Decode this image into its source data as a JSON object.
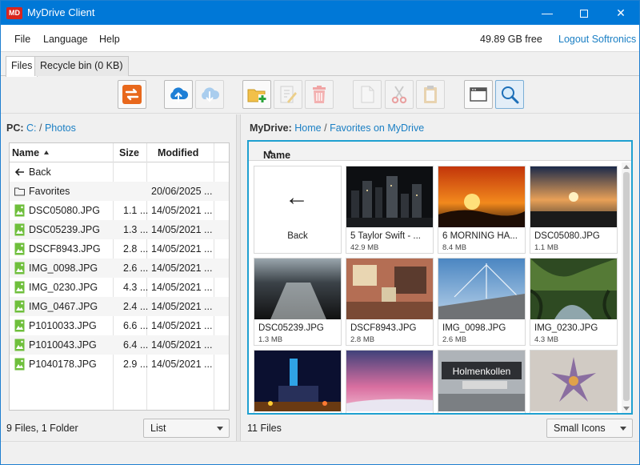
{
  "window": {
    "title": "MyDrive Client",
    "logo_text": "MD"
  },
  "menu": {
    "items": [
      "File",
      "Language",
      "Help"
    ],
    "free_space": "49.89 GB free",
    "logout": "Logout Softronics"
  },
  "tabs": [
    {
      "label": "Files",
      "active": true
    },
    {
      "label": "Recycle bin (0 KB)",
      "active": false
    }
  ],
  "toolbar": {
    "buttons": [
      "sync-icon",
      "upload-icon",
      "download-icon",
      "new-folder-icon",
      "rename-icon",
      "delete-icon",
      "copy-icon",
      "cut-icon",
      "paste-icon",
      "window-icon",
      "search-icon"
    ]
  },
  "left": {
    "path_label": "PC:",
    "path": [
      "C:",
      "Photos"
    ],
    "columns": [
      "Name",
      "Size",
      "Modified"
    ],
    "rows": [
      {
        "name": "Back",
        "size": "",
        "modified": "",
        "icon": "back-arrow-icon"
      },
      {
        "name": "Favorites",
        "size": "",
        "modified": "20/06/2025 ...",
        "icon": "folder-icon"
      },
      {
        "name": "DSC05080.JPG",
        "size": "1.1 ...",
        "modified": "14/05/2021 ...",
        "icon": "image-file-icon"
      },
      {
        "name": "DSC05239.JPG",
        "size": "1.3 ...",
        "modified": "14/05/2021 ...",
        "icon": "image-file-icon"
      },
      {
        "name": "DSCF8943.JPG",
        "size": "2.8 ...",
        "modified": "14/05/2021 ...",
        "icon": "image-file-icon"
      },
      {
        "name": "IMG_0098.JPG",
        "size": "2.6 ...",
        "modified": "14/05/2021 ...",
        "icon": "image-file-icon"
      },
      {
        "name": "IMG_0230.JPG",
        "size": "4.3 ...",
        "modified": "14/05/2021 ...",
        "icon": "image-file-icon"
      },
      {
        "name": "IMG_0467.JPG",
        "size": "2.4 ...",
        "modified": "14/05/2021 ...",
        "icon": "image-file-icon"
      },
      {
        "name": "P1010033.JPG",
        "size": "6.6 ...",
        "modified": "14/05/2021 ...",
        "icon": "image-file-icon"
      },
      {
        "name": "P1010043.JPG",
        "size": "6.4 ...",
        "modified": "14/05/2021 ...",
        "icon": "image-file-icon"
      },
      {
        "name": "P1040178.JPG",
        "size": "2.9 ...",
        "modified": "14/05/2021 ...",
        "icon": "image-file-icon"
      }
    ],
    "status": "9 Files, 1 Folder",
    "view_mode": "List"
  },
  "right": {
    "path_label": "MyDrive:",
    "path": [
      "Home",
      "Favorites on MyDrive"
    ],
    "column": "Name",
    "tiles": [
      {
        "name": "Back",
        "size": "",
        "kind": "back"
      },
      {
        "name": "5 Taylor Swift - ...",
        "size": "42.9 MB",
        "kind": "night-city"
      },
      {
        "name": "6 MORNING HA...",
        "size": "8.4 MB",
        "kind": "orange-sunset"
      },
      {
        "name": "DSC05080.JPG",
        "size": "1.1 MB",
        "kind": "dusk-pier"
      },
      {
        "name": "DSC05239.JPG",
        "size": "1.3 MB",
        "kind": "sea-shine"
      },
      {
        "name": "DSCF8943.JPG",
        "size": "2.8 MB",
        "kind": "room"
      },
      {
        "name": "IMG_0098.JPG",
        "size": "2.6 MB",
        "kind": "bridge"
      },
      {
        "name": "IMG_0230.JPG",
        "size": "4.3 MB",
        "kind": "mangrove"
      },
      {
        "name": "",
        "size": "",
        "kind": "neon-night"
      },
      {
        "name": "",
        "size": "",
        "kind": "pink-sky"
      },
      {
        "name": "",
        "size": "",
        "kind": "holmenkollen",
        "sign_text": "Holmenkollen"
      },
      {
        "name": "",
        "size": "",
        "kind": "starfish"
      }
    ],
    "status": "11 Files",
    "view_mode": "Small Icons"
  },
  "colors": {
    "titlebar": "#0078d7",
    "accent_border": "#1fa0d0",
    "link": "#1a7fc4"
  }
}
